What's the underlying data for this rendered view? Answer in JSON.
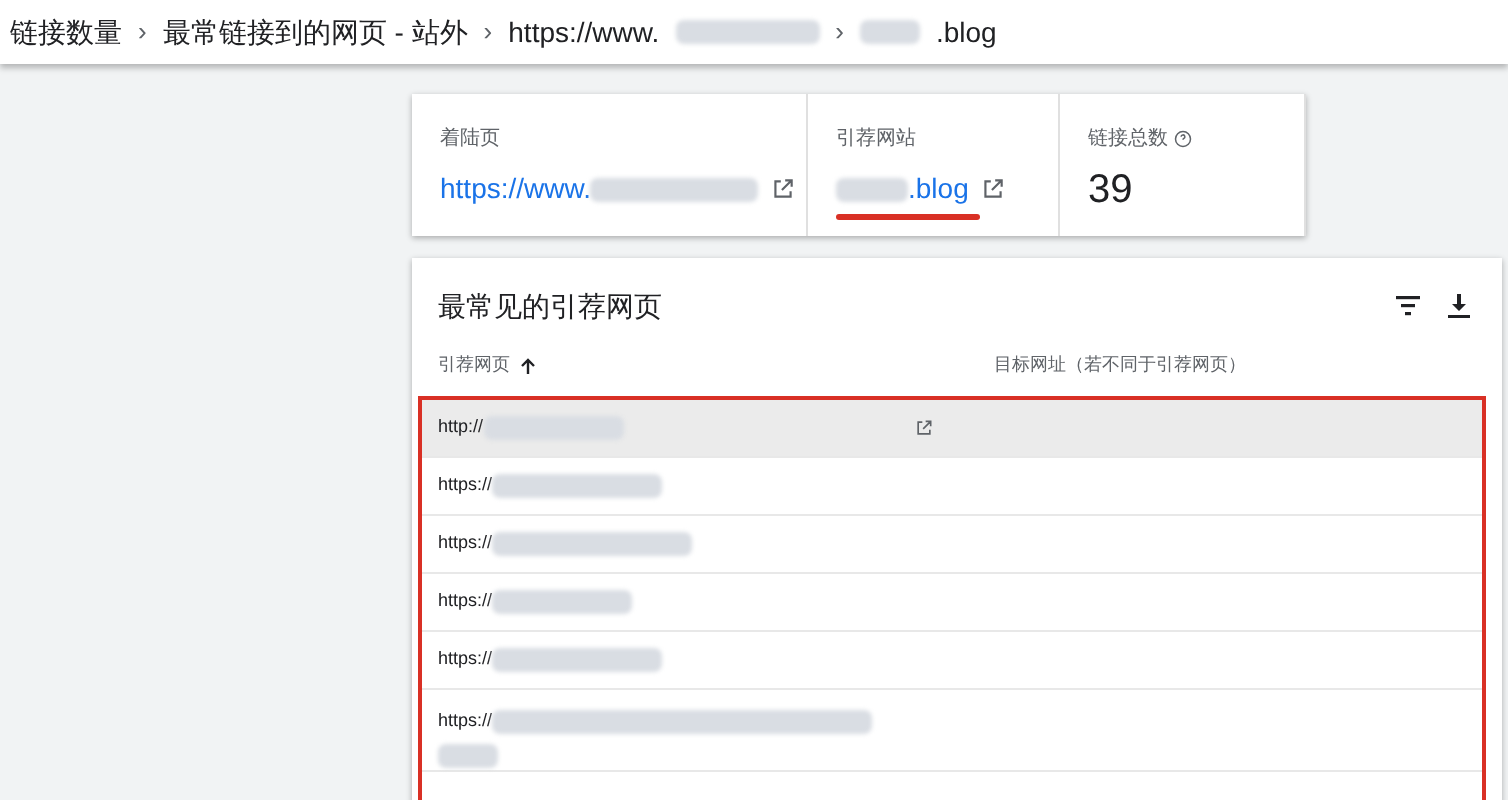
{
  "separator": "›",
  "breadcrumb": [
    {
      "text": "链接数量",
      "redacted": false
    },
    {
      "text": "最常链接到的网页 - 站外",
      "redacted": false
    },
    {
      "text": "https://www.",
      "redacted": true
    },
    {
      "text": ".blog",
      "redacted": true,
      "lead": true
    }
  ],
  "summary": [
    {
      "label": "着陆页",
      "value": "https://www.",
      "kind": "link",
      "redacted": true,
      "underlined": false
    },
    {
      "label": "引荐网站",
      "value": ".blog",
      "kind": "link",
      "redacted": true,
      "lead": true,
      "underlined": true
    },
    {
      "label": "链接总数",
      "value": "39",
      "kind": "count",
      "help": true
    }
  ],
  "table": {
    "title": "最常见的引荐网页",
    "columns": [
      {
        "label": "引荐网页",
        "sorted": true
      },
      {
        "label": "目标网址（若不同于引荐网页）",
        "sorted": false
      }
    ],
    "rows": [
      {
        "url": "http://",
        "selected": true,
        "wide": false
      },
      {
        "url": "https://",
        "selected": false,
        "wide": false
      },
      {
        "url": "https://",
        "selected": false,
        "wide": false
      },
      {
        "url": "https://",
        "selected": false,
        "wide": false
      },
      {
        "url": "https://",
        "selected": false,
        "wide": false
      },
      {
        "url": "https://",
        "selected": false,
        "wide": true
      }
    ]
  }
}
